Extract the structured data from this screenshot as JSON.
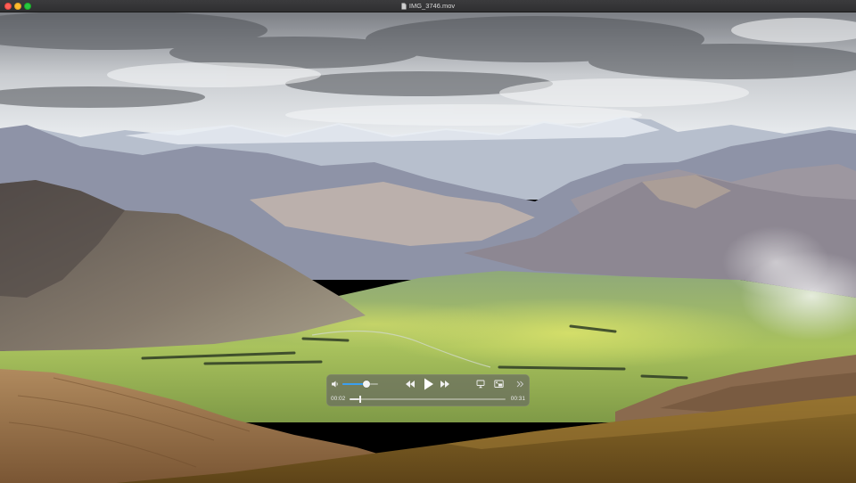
{
  "window": {
    "title": "IMG_3746.mov",
    "file_icon": "document-icon"
  },
  "player": {
    "current_time": "00:02",
    "duration": "00:31",
    "playback_progress": 0.065,
    "volume_level": 0.67,
    "icons": {
      "volume": "speaker-icon",
      "rewind": "rewind-icon",
      "play": "play-icon",
      "forward": "fast-forward-icon",
      "airplay": "airplay-icon",
      "pip": "picture-in-picture-icon",
      "more": "chevrons-right-icon"
    },
    "colors": {
      "volume_accent": "#3b9ff0",
      "hud_background": "#696c60"
    }
  }
}
